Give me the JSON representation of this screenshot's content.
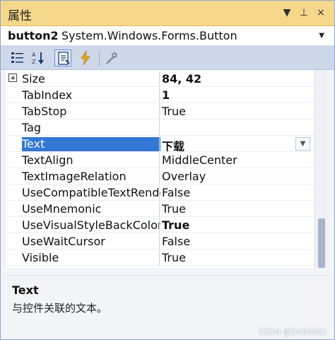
{
  "window": {
    "title": "属性",
    "controls": [
      "▼",
      "⊥",
      "×"
    ]
  },
  "object_selector": {
    "name": "button2",
    "type": "System.Windows.Forms.Button"
  },
  "toolbar": {
    "icons": [
      "categorized-icon",
      "alphabetical-icon",
      "properties-icon",
      "events-icon",
      "property-pages-icon"
    ]
  },
  "properties": [
    {
      "name": "Size",
      "value": "84, 42",
      "bold": true,
      "expandable": true
    },
    {
      "name": "TabIndex",
      "value": "1",
      "bold": true
    },
    {
      "name": "TabStop",
      "value": "True"
    },
    {
      "name": "Tag",
      "value": ""
    },
    {
      "name": "Text",
      "value": "下载",
      "bold": true,
      "selected": true
    },
    {
      "name": "TextAlign",
      "value": "MiddleCenter"
    },
    {
      "name": "TextImageRelation",
      "value": "Overlay"
    },
    {
      "name": "UseCompatibleTextRende",
      "value": "False"
    },
    {
      "name": "UseMnemonic",
      "value": "True"
    },
    {
      "name": "UseVisualStyleBackColor",
      "value": "True",
      "bold": true
    },
    {
      "name": "UseWaitCursor",
      "value": "False"
    },
    {
      "name": "Visible",
      "value": "True"
    }
  ],
  "description": {
    "title": "Text",
    "text": "与控件关联的文本。"
  },
  "watermark": "CSDN @DXB2021",
  "colors": {
    "title_bar": "#f5d88b",
    "toolbar": "#ced8ea",
    "selection": "#3377d6"
  }
}
